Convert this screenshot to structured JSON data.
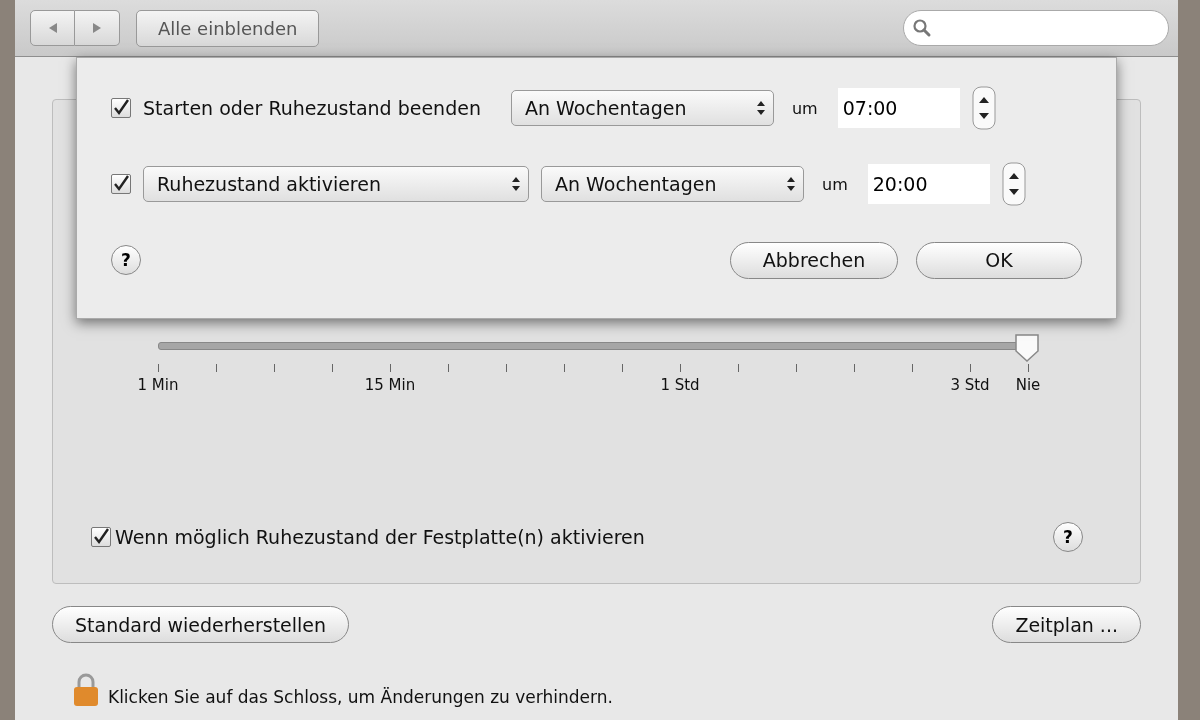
{
  "toolbar": {
    "show_all_button": "Alle einblenden"
  },
  "schedule_sheet": {
    "rows": [
      {
        "kind": "label",
        "checked": true,
        "label": "Starten oder Ruhezustand beenden",
        "days": "An Wochentagen",
        "at": "um",
        "time": "07:00"
      },
      {
        "kind": "popup",
        "checked": true,
        "action": "Ruhezustand aktivieren",
        "days": "An Wochentagen",
        "at": "um",
        "time": "20:00"
      }
    ],
    "help_button": "?",
    "buttons": [
      "Abbrechen",
      "OK"
    ]
  },
  "display_sleep": {
    "level": 1,
    "scale_labels": [
      "1 Min",
      "15 Min",
      "1 Std",
      "3 Std",
      "Nie"
    ]
  },
  "disk_sleep": {
    "checked": true,
    "label": "Wenn möglich Ruhezustand der Festplatte(n) aktivieren",
    "help_button": "?"
  },
  "buttons": [
    "Standard wiederherstellen",
    "Zeitplan ..."
  ],
  "lock_message": "Klicken Sie auf das Schloss, um Änderungen zu verhindern."
}
